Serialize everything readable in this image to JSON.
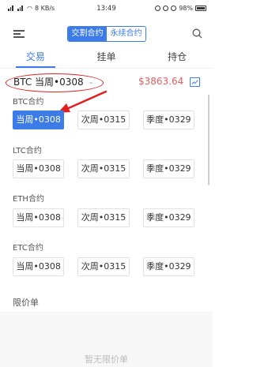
{
  "status_bar": {
    "signal": "#1 #1",
    "speed": "8 KB/s",
    "time": "13:49",
    "battery": "98%"
  },
  "header": {
    "segment_active": "交割合约",
    "segment_inactive": "永续合约"
  },
  "tabs": [
    "交易",
    "挂单",
    "持仓"
  ],
  "pair": {
    "label": "BTC 当周•0308",
    "price": "$3863.64"
  },
  "sections": [
    {
      "title": "BTC合约",
      "buttons": [
        "当周•0308",
        "次周•0315",
        "季度•0329"
      ],
      "selected": 0
    },
    {
      "title": "LTC合约",
      "buttons": [
        "当周•0308",
        "次周•0315",
        "季度•0329"
      ],
      "selected": -1
    },
    {
      "title": "ETH合约",
      "buttons": [
        "当周•0308",
        "次周•0315",
        "季度•0329"
      ],
      "selected": -1
    },
    {
      "title": "ETC合约",
      "buttons": [
        "当周•0308",
        "次周•0315",
        "季度•0329"
      ],
      "selected": -1
    }
  ],
  "limit_orders": {
    "title": "限价单",
    "empty": "暂无限价单"
  },
  "colors": {
    "accent": "#3c7be8",
    "price": "#e55e5e",
    "annotation": "#e02020"
  }
}
